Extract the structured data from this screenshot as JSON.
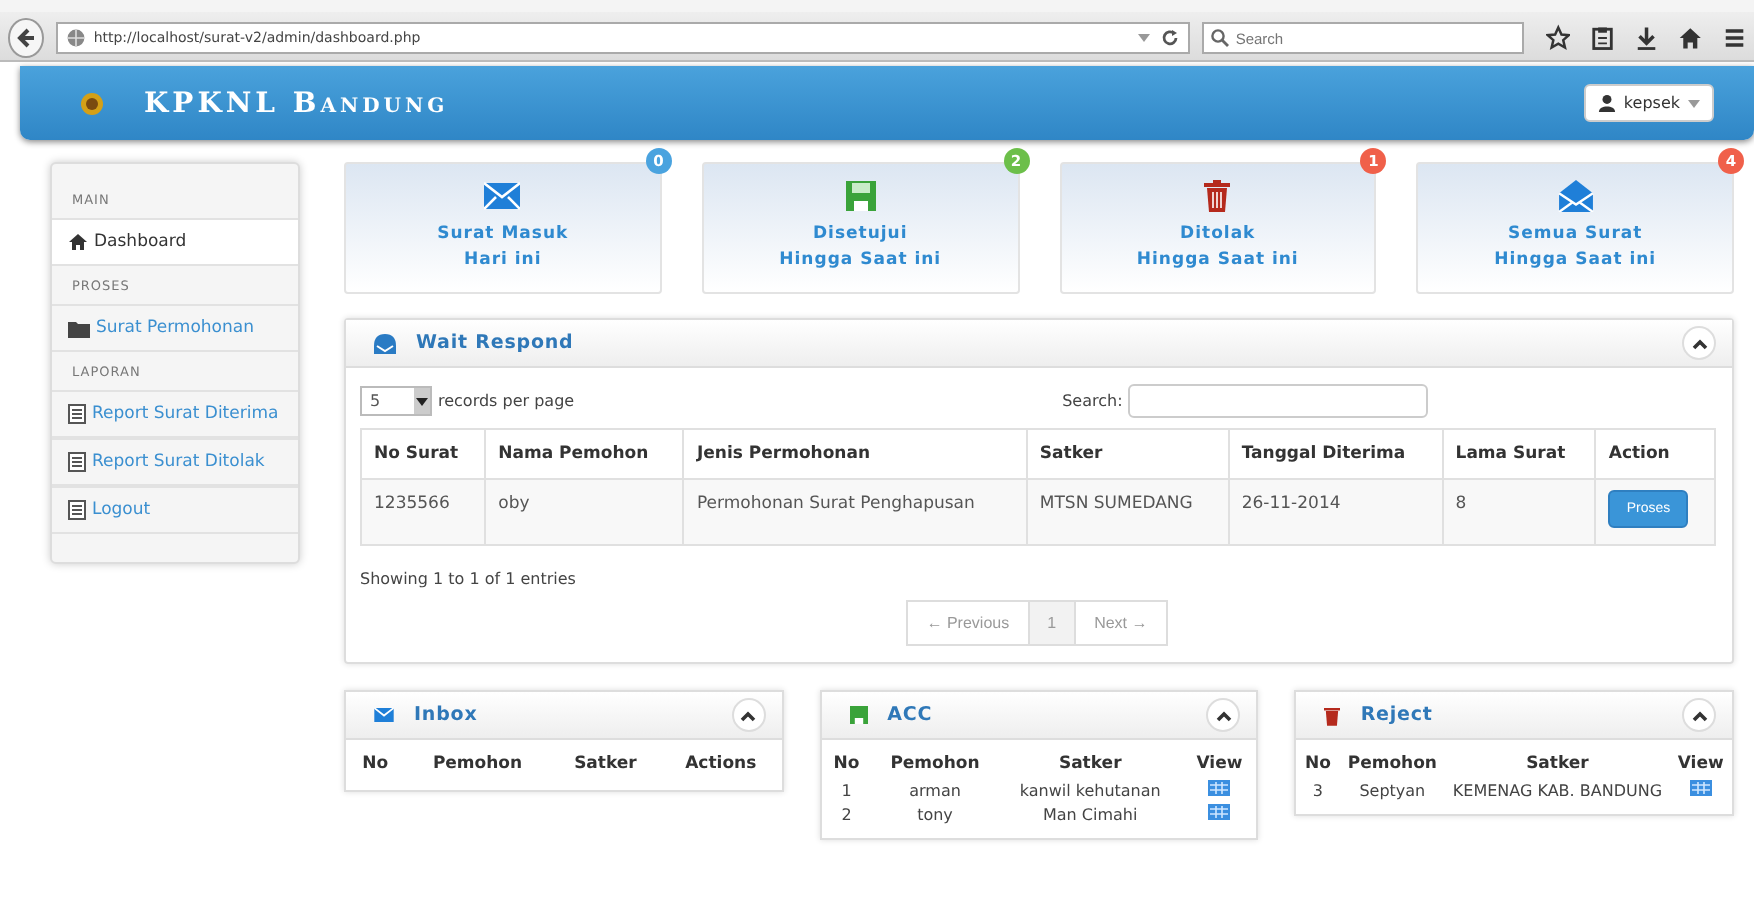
{
  "browser": {
    "url": "http://localhost/surat-v2/admin/dashboard.php",
    "search_placeholder": "Search"
  },
  "header": {
    "title": "KPKNL Bandung",
    "user": "kepsek"
  },
  "sidebar": [
    {
      "heading": "MAIN",
      "items": [
        {
          "label": "Dashboard",
          "selected": true
        }
      ]
    },
    {
      "heading": "PROSES",
      "items": [
        {
          "label": "Surat Permohonan",
          "selected": false
        }
      ]
    },
    {
      "heading": "LAPORAN",
      "items": [
        {
          "label": "Report Surat Diterima",
          "selected": false
        },
        {
          "label": "Report Surat Ditolak",
          "selected": false
        },
        {
          "label": "Logout",
          "selected": false
        }
      ]
    }
  ],
  "stats": [
    {
      "title": "Surat Masuk",
      "subtitle": "Hari ini",
      "count": "0",
      "color": "#4aa3df"
    },
    {
      "title": "Disetujui",
      "subtitle": "Hingga Saat ini",
      "count": "2",
      "color": "#6cbf4a"
    },
    {
      "title": "Ditolak",
      "subtitle": "Hingga Saat ini",
      "count": "1",
      "color": "#f0604a"
    },
    {
      "title": "Semua Surat",
      "subtitle": "Hingga Saat ini",
      "count": "4",
      "color": "#f0604a"
    }
  ],
  "wait_panel": {
    "title": "Wait Respond",
    "page_size": "5",
    "page_size_label": "records per page",
    "search_label": "Search:",
    "columns": [
      "No Surat",
      "Nama Pemohon",
      "Jenis Permohonan",
      "Satker",
      "Tanggal Diterima",
      "Lama Surat",
      "Action"
    ],
    "rows": [
      {
        "cells": [
          "1235566",
          "oby",
          "Permohonan Surat Penghapusan",
          "MTSN SUMEDANG",
          "26-11-2014",
          "8"
        ],
        "action": "Proses"
      }
    ],
    "info": "Showing 1 to 1 of 1 entries",
    "previous": "← Previous",
    "pages": [
      {
        "label": "1",
        "selected": true
      }
    ],
    "next": "Next →"
  },
  "small_panels": [
    {
      "title": "Inbox",
      "columns": [
        "No",
        "Pemohon",
        "Satker",
        "Actions"
      ]
    },
    {
      "title": "ACC",
      "columns": [
        "No",
        "Pemohon",
        "Satker",
        "View"
      ],
      "rows": [
        [
          "1",
          "arman",
          "kanwil kehutanan"
        ],
        [
          "2",
          "tony",
          "Man Cimahi"
        ]
      ]
    },
    {
      "title": "Reject",
      "columns": [
        "No",
        "Pemohon",
        "Satker",
        "View"
      ],
      "rows": [
        [
          "3",
          "Septyan",
          "KEMENAG KAB. BANDUNG"
        ]
      ]
    }
  ]
}
